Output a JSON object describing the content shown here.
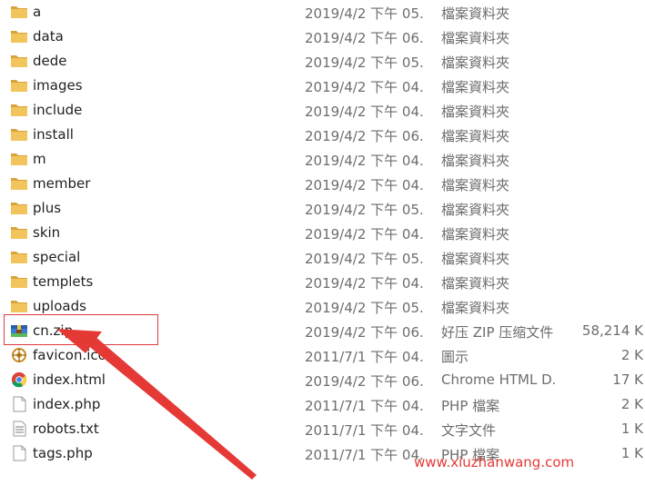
{
  "files": [
    {
      "name": "a",
      "date": "2019/4/2 下午 05...",
      "type": "檔案資料夾",
      "size": "",
      "icon": "folder-icon"
    },
    {
      "name": "data",
      "date": "2019/4/2 下午 06...",
      "type": "檔案資料夾",
      "size": "",
      "icon": "folder-icon"
    },
    {
      "name": "dede",
      "date": "2019/4/2 下午 05...",
      "type": "檔案資料夾",
      "size": "",
      "icon": "folder-icon"
    },
    {
      "name": "images",
      "date": "2019/4/2 下午 04...",
      "type": "檔案資料夾",
      "size": "",
      "icon": "folder-icon"
    },
    {
      "name": "include",
      "date": "2019/4/2 下午 04...",
      "type": "檔案資料夾",
      "size": "",
      "icon": "folder-icon"
    },
    {
      "name": "install",
      "date": "2019/4/2 下午 06...",
      "type": "檔案資料夾",
      "size": "",
      "icon": "folder-icon"
    },
    {
      "name": "m",
      "date": "2019/4/2 下午 04...",
      "type": "檔案資料夾",
      "size": "",
      "icon": "folder-icon"
    },
    {
      "name": "member",
      "date": "2019/4/2 下午 04...",
      "type": "檔案資料夾",
      "size": "",
      "icon": "folder-icon"
    },
    {
      "name": "plus",
      "date": "2019/4/2 下午 05...",
      "type": "檔案資料夾",
      "size": "",
      "icon": "folder-icon"
    },
    {
      "name": "skin",
      "date": "2019/4/2 下午 04...",
      "type": "檔案資料夾",
      "size": "",
      "icon": "folder-icon"
    },
    {
      "name": "special",
      "date": "2019/4/2 下午 05...",
      "type": "檔案資料夾",
      "size": "",
      "icon": "folder-icon"
    },
    {
      "name": "templets",
      "date": "2019/4/2 下午 04...",
      "type": "檔案資料夾",
      "size": "",
      "icon": "folder-icon"
    },
    {
      "name": "uploads",
      "date": "2019/4/2 下午 05...",
      "type": "檔案資料夾",
      "size": "",
      "icon": "folder-icon"
    },
    {
      "name": "cn.zip",
      "date": "2019/4/2 下午 06...",
      "type": "好压 ZIP 压缩文件",
      "size": "58,214 K",
      "icon": "zip-archive-icon"
    },
    {
      "name": "favicon.ico",
      "date": "2011/7/1 下午 04...",
      "type": "圖示",
      "size": "2 K",
      "icon": "favicon-icon"
    },
    {
      "name": "index.html",
      "date": "2019/4/2 下午 06...",
      "type": "Chrome HTML D...",
      "size": "17 K",
      "icon": "chrome-icon"
    },
    {
      "name": "index.php",
      "date": "2011/7/1 下午 04...",
      "type": "PHP 檔案",
      "size": "2 K",
      "icon": "php-file-icon"
    },
    {
      "name": "robots.txt",
      "date": "2011/7/1 下午 04...",
      "type": "文字文件",
      "size": "1 K",
      "icon": "text-file-icon"
    },
    {
      "name": "tags.php",
      "date": "2011/7/1 下午 04...",
      "type": "PHP 檔案",
      "size": "1 K",
      "icon": "php-file-icon"
    }
  ],
  "highlighted_file": "cn.zip",
  "watermark": "www.xiuzhanwang.com",
  "colors": {
    "folder": "#e8b84a",
    "annotation_red": "#e53935",
    "secondary_text": "#6d6d6d"
  }
}
